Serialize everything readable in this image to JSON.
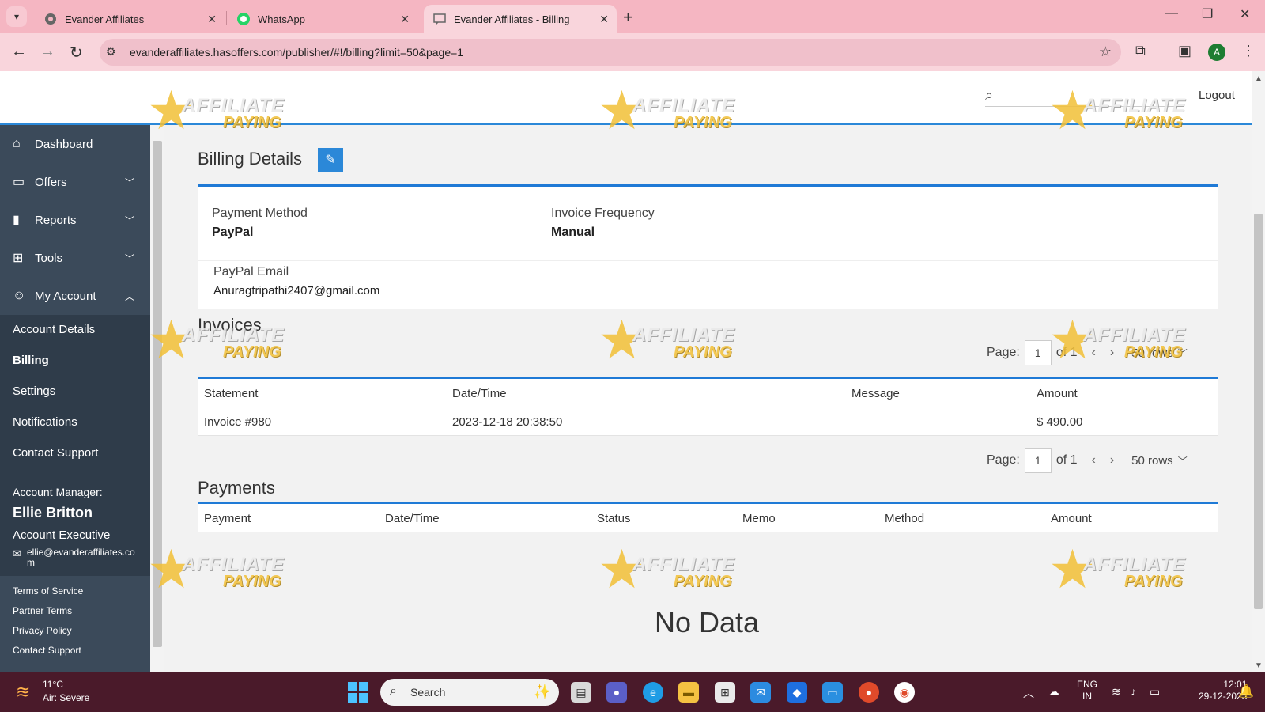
{
  "browser": {
    "tabs": [
      {
        "title": "Evander Affiliates"
      },
      {
        "title": "WhatsApp"
      },
      {
        "title": "Evander Affiliates - Billing"
      }
    ],
    "url": "evanderaffiliates.hasoffers.com/publisher/#!/billing?limit=50&page=1",
    "profile_initial": "A"
  },
  "header": {
    "logout_label": "Logout",
    "watermark_text_1": "AFFILIATE",
    "watermark_text_2": "PAYING"
  },
  "sidebar": {
    "items": [
      {
        "label": "Dashboard",
        "icon": "home-icon"
      },
      {
        "label": "Offers",
        "icon": "chat-icon"
      },
      {
        "label": "Reports",
        "icon": "bar-chart-icon"
      },
      {
        "label": "Tools",
        "icon": "tools-icon"
      },
      {
        "label": "My Account",
        "icon": "user-icon"
      }
    ],
    "subitems": [
      {
        "label": "Account Details"
      },
      {
        "label": "Billing"
      },
      {
        "label": "Settings"
      },
      {
        "label": "Notifications"
      },
      {
        "label": "Contact Support"
      }
    ],
    "manager": {
      "label": "Account Manager:",
      "name": "Ellie Britton",
      "title": "Account Executive",
      "email": "ellie@evanderaffiliates.com"
    },
    "footer_links": [
      {
        "label": "Terms of Service"
      },
      {
        "label": "Partner Terms"
      },
      {
        "label": "Privacy Policy"
      },
      {
        "label": "Contact Support"
      }
    ]
  },
  "billing": {
    "title": "Billing Details",
    "payment_method_label": "Payment Method",
    "payment_method_value": "PayPal",
    "invoice_frequency_label": "Invoice Frequency",
    "invoice_frequency_value": "Manual",
    "paypal_email_label": "PayPal Email",
    "paypal_email_value": "Anuragtripathi2407@gmail.com"
  },
  "invoices": {
    "title": "Invoices",
    "pager": {
      "label": "Page:",
      "page": "1",
      "of": "of 1",
      "rows": "50 rows"
    },
    "columns": [
      "Statement",
      "Date/Time",
      "Message",
      "Amount"
    ],
    "rows": [
      {
        "statement": "Invoice #980",
        "datetime": "2023-12-18 20:38:50",
        "message": "",
        "amount": "$ 490.00"
      }
    ]
  },
  "payments": {
    "title": "Payments",
    "columns": [
      "Payment",
      "Date/Time",
      "Status",
      "Memo",
      "Method",
      "Amount"
    ],
    "empty_text": "No Data"
  },
  "taskbar": {
    "temperature": "11°C",
    "weather_status": "Air: Severe",
    "search_placeholder": "Search",
    "lang_1": "ENG",
    "lang_2": "IN",
    "time": "12:01",
    "date": "29-12-2023"
  },
  "colors": {
    "accent": "#1f7ad6",
    "sidebar": "#3b4a5a",
    "tabbar": "#f5b6c2"
  }
}
